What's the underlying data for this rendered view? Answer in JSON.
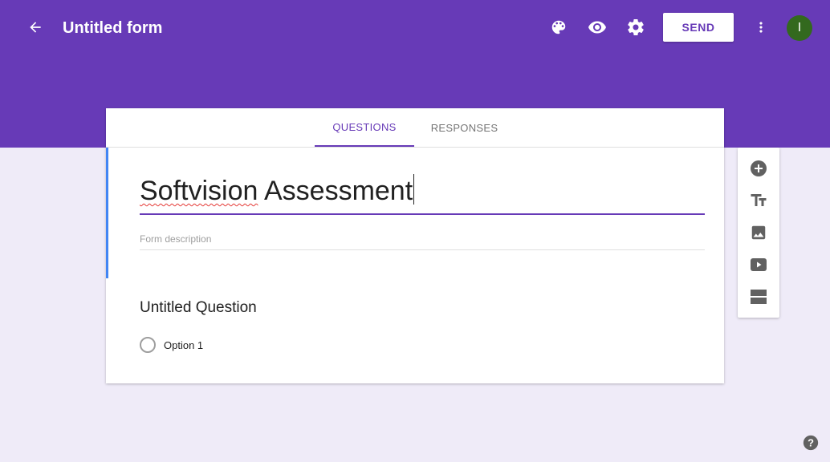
{
  "app": {
    "title": "Untitled form",
    "send_label": "SEND",
    "avatar_initial": "I",
    "colors": {
      "brand": "#673ab7",
      "background": "#efebf8",
      "avatar": "#33691e",
      "accent_bar": "#4285f4"
    }
  },
  "header": {
    "icons": [
      "back-arrow-icon",
      "palette-icon",
      "eye-icon",
      "gear-icon",
      "more-vert-icon"
    ]
  },
  "tabs": [
    {
      "label": "QUESTIONS",
      "active": true
    },
    {
      "label": "RESPONSES",
      "active": false
    }
  ],
  "form": {
    "title_word1": "Softvision",
    "title_word2": " Assessment",
    "description_placeholder": "Form description",
    "question": {
      "title": "Untitled Question",
      "options": [
        "Option 1"
      ]
    }
  },
  "toolbar": {
    "tools": [
      "add-question-icon",
      "title-text-icon",
      "image-icon",
      "video-icon",
      "section-icon"
    ]
  },
  "footer": {
    "icon": "help-icon"
  }
}
